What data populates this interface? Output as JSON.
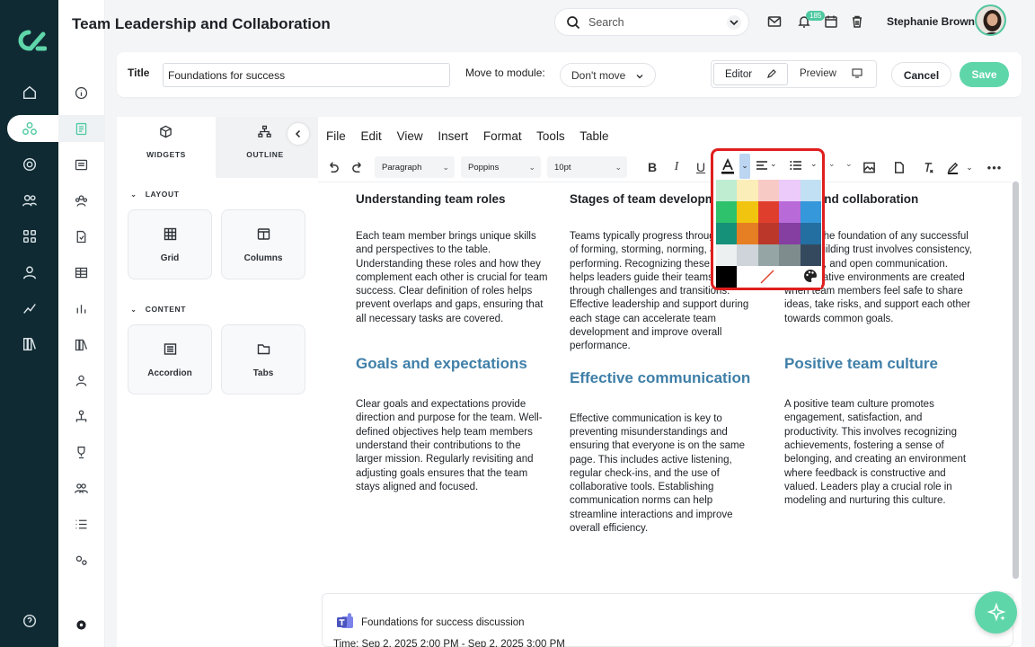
{
  "header": {
    "title": "Team Leadership and Collaboration",
    "search_placeholder": "Search",
    "notification_count": "185",
    "user_name": "Stephanie Brown"
  },
  "title_bar": {
    "title_label": "Title",
    "title_value": "Foundations for success",
    "move_label": "Move to module:",
    "move_value": "Don't move",
    "editor_label": "Editor",
    "preview_label": "Preview",
    "cancel_label": "Cancel",
    "save_label": "Save"
  },
  "widgets_panel": {
    "tabs": [
      "WIDGETS",
      "OUTLINE"
    ],
    "layout_section": "LAYOUT",
    "content_section": "CONTENT",
    "layout_items": [
      "Grid",
      "Columns"
    ],
    "content_items": [
      "Accordion",
      "Tabs"
    ]
  },
  "editor": {
    "menu": [
      "File",
      "Edit",
      "View",
      "Insert",
      "Format",
      "Tools",
      "Table"
    ],
    "block_format": "Paragraph",
    "font_family": "Poppins",
    "font_size": "10pt"
  },
  "document": {
    "columns": [
      {
        "heading": "Understanding team roles",
        "body": "Each team member brings unique skills and perspectives to the table. Understanding these roles and how they complement each other is crucial for team success. Clear definition of roles helps prevent overlaps and gaps, ensuring that all necessary tasks are covered.",
        "heading2": "Goals and expectations",
        "body2": "Clear goals and expectations provide direction and purpose for the team. Well-defined objectives help team members understand their contributions to the larger mission. Regularly revisiting and adjusting goals ensures that the team stays aligned and focused."
      },
      {
        "heading": "Stages of team development",
        "body": "Teams typically progress through stages of forming, storming, norming, and performing. Recognizing these stages helps leaders guide their teams effectively through challenges and transitions. Effective leadership and support during each stage can accelerate team development and improve overall performance.",
        "heading2": "Effective communication",
        "body2": "Effective communication is key to preventing misunderstandings and ensuring that everyone is on the same page. This includes active listening, regular check-ins, and the use of collaborative tools. Establishing communication norms can help streamline interactions and improve overall efficiency."
      },
      {
        "heading": "Trust and collaboration",
        "body": "Trust is the foundation of any successful team. Building trust involves consistency, reliability, and open communication. Collaborative environments are created when team members feel safe to share ideas, take risks, and support each other towards common goals.",
        "heading2": "Positive team culture",
        "body2": "A positive team culture promotes engagement, satisfaction, and productivity. This involves recognizing achievements, fostering a sense of belonging, and creating an environment where feedback is constructive and valued. Leaders play a crucial role in modeling and nurturing this culture."
      }
    ]
  },
  "teams_meeting": {
    "title": "Foundations for success discussion",
    "time": "Time: Sep 2, 2025 2:00 PM - Sep 2, 2025 3:00 PM"
  },
  "color_picker": {
    "swatches": [
      [
        "#bfedd2",
        "#fbeeb8",
        "#f8cac6",
        "#eccafa",
        "#c2e0f4"
      ],
      [
        "#2dc26b",
        "#f1c40f",
        "#e03e2d",
        "#b96ad9",
        "#3598db"
      ],
      [
        "#169179",
        "#e67e23",
        "#ba372a",
        "#843fa1",
        "#236fa1"
      ],
      [
        "#ecf0f1",
        "#ced4d9",
        "#95a5a6",
        "#7e8c8d",
        "#34495e"
      ],
      [
        "#000000",
        "#ffffff"
      ]
    ],
    "highlight_color": "#e01e1e"
  }
}
